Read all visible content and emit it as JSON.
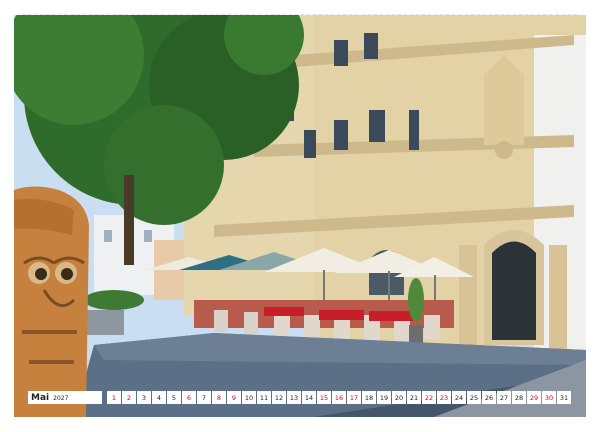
{
  "calendar": {
    "month": "Mai",
    "year": "2027",
    "days": [
      {
        "num": "1",
        "weekend": true
      },
      {
        "num": "2",
        "weekend": true
      },
      {
        "num": "3",
        "weekend": false
      },
      {
        "num": "4",
        "weekend": false
      },
      {
        "num": "5",
        "weekend": false
      },
      {
        "num": "6",
        "weekend": true
      },
      {
        "num": "7",
        "weekend": false
      },
      {
        "num": "8",
        "weekend": true
      },
      {
        "num": "9",
        "weekend": true
      },
      {
        "num": "10",
        "weekend": false
      },
      {
        "num": "11",
        "weekend": false
      },
      {
        "num": "12",
        "weekend": false
      },
      {
        "num": "13",
        "weekend": false
      },
      {
        "num": "14",
        "weekend": false
      },
      {
        "num": "15",
        "weekend": true
      },
      {
        "num": "16",
        "weekend": true
      },
      {
        "num": "17",
        "weekend": true
      },
      {
        "num": "18",
        "weekend": false
      },
      {
        "num": "19",
        "weekend": false
      },
      {
        "num": "20",
        "weekend": false
      },
      {
        "num": "21",
        "weekend": false
      },
      {
        "num": "22",
        "weekend": true
      },
      {
        "num": "23",
        "weekend": true
      },
      {
        "num": "24",
        "weekend": false
      },
      {
        "num": "25",
        "weekend": false
      },
      {
        "num": "26",
        "weekend": false
      },
      {
        "num": "27",
        "weekend": false
      },
      {
        "num": "28",
        "weekend": false
      },
      {
        "num": "29",
        "weekend": true
      },
      {
        "num": "30",
        "weekend": true
      },
      {
        "num": "31",
        "weekend": false
      }
    ]
  },
  "colors": {
    "weekend": "#d0021b",
    "sky": "#b9d3e8",
    "facade": "#e6d6ae",
    "umbrella": "#f1ede2",
    "chair_red": "#c81e2a"
  }
}
